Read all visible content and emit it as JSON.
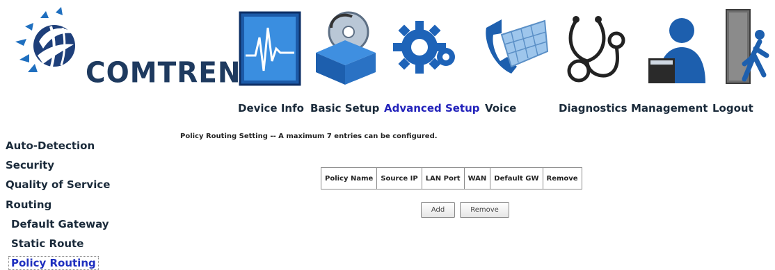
{
  "brand": {
    "name": "COMTREND",
    "color": "#1e3a5f"
  },
  "nav": {
    "items": [
      {
        "label": "Device Info",
        "icon": "device-info-monitor-icon"
      },
      {
        "label": "Basic Setup",
        "icon": "basic-setup-box-icon"
      },
      {
        "label": "Advanced Setup",
        "icon": "advanced-setup-gears-icon",
        "active": true
      },
      {
        "label": "Voice",
        "icon": "voice-phone-icon"
      },
      {
        "label": "Diagnostics",
        "icon": "diagnostics-stethoscope-icon"
      },
      {
        "label": "Management",
        "icon": "management-person-icon"
      },
      {
        "label": "Logout",
        "icon": "logout-door-icon"
      }
    ],
    "active_color": "#2222bb"
  },
  "sidebar": {
    "items": [
      {
        "label": "Auto-Detection"
      },
      {
        "label": "Security"
      },
      {
        "label": "Quality of Service"
      },
      {
        "label": "Routing"
      },
      {
        "label": "Default Gateway",
        "sub": true
      },
      {
        "label": "Static Route",
        "sub": true
      },
      {
        "label": "Policy Routing",
        "sub": true,
        "active": true
      }
    ]
  },
  "main": {
    "title": "Policy Routing Setting -- A maximum 7 entries can be configured.",
    "table": {
      "headers": [
        "Policy Name",
        "Source IP",
        "LAN Port",
        "WAN",
        "Default GW",
        "Remove"
      ]
    },
    "buttons": {
      "add": "Add",
      "remove": "Remove"
    }
  }
}
